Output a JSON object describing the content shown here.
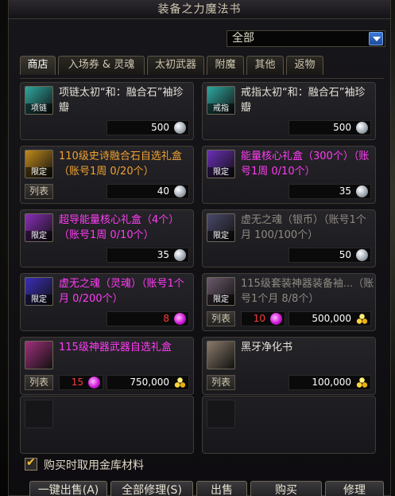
{
  "window": {
    "title": "装备之力魔法书"
  },
  "filter": {
    "selected": "全部"
  },
  "tabs": [
    "商店",
    "入场券 & 灵魂",
    "太初武器",
    "附魔",
    "其他",
    "返物"
  ],
  "items": [
    {
      "name": "项链太初“和：融合石”袖珍瓣",
      "color": "white",
      "icon_tag": "项链",
      "icon_color": "#2fa8a0",
      "price": "500",
      "currency": "silver",
      "list_button": ""
    },
    {
      "name": "戒指太初“和：融合石”袖珍瓣",
      "color": "white",
      "icon_tag": "戒指",
      "icon_color": "#2fa8a0",
      "price": "500",
      "currency": "silver",
      "list_button": ""
    },
    {
      "name": "110级史诗融合石自选礼盒（账号1周 0/20个）",
      "color": "orange",
      "icon_tag": "限定",
      "icon_color": "#c08a1a",
      "price": "40",
      "currency": "silver",
      "list_button": "列表"
    },
    {
      "name": "能量核心礼盒（300个）（账号1周 0/10个）",
      "color": "magenta",
      "icon_tag": "限定",
      "icon_color": "#6a2fb8",
      "price": "35",
      "currency": "silver",
      "list_button": ""
    },
    {
      "name": "超导能量核心礼盒（4个）（账号1周 0/10个）",
      "color": "magenta",
      "icon_tag": "限定",
      "icon_color": "#8a2fb8",
      "price": "35",
      "currency": "silver",
      "list_button": ""
    },
    {
      "name": "虚无之魂（银币）（账号1个月 100/100个）",
      "color": "grey",
      "icon_tag": "限定",
      "icon_color": "#4a4a6a",
      "price": "50",
      "currency": "silver",
      "list_button": ""
    },
    {
      "name": "虚无之魂（灵魂）（账号1个月 0/200个）",
      "color": "magenta",
      "icon_tag": "限定",
      "icon_color": "#3a2fb8",
      "price": "8",
      "price_red": true,
      "currency": "gem",
      "list_button": ""
    },
    {
      "name": "115级套装神器装备袖...（账号1个月 8/8个）",
      "color": "grey",
      "icon_tag": "限定",
      "icon_color": "#6a5a6a",
      "extra_count": "10",
      "price": "500,000",
      "currency": "gold",
      "list_button": "列表"
    },
    {
      "name": "115级神器武器自选礼盒",
      "color": "magenta",
      "icon_tag": "",
      "icon_color": "#a0307a",
      "extra_count": "15",
      "price": "750,000",
      "currency": "gold",
      "list_button": "列表"
    },
    {
      "name": "黑牙净化书",
      "color": "white",
      "icon_tag": "",
      "icon_color": "#8a7a6a",
      "price": "100,000",
      "currency": "gold",
      "list_button": "列表"
    }
  ],
  "option": {
    "label": "购买时取用金库材料",
    "checked": true
  },
  "buttons": [
    "一键出售(A)",
    "全部修理(S)",
    "出售",
    "购买",
    "修理"
  ],
  "colors": {
    "accent": "#f0a232",
    "magenta": "#ff3cf5",
    "red": "#ff3b3b"
  }
}
